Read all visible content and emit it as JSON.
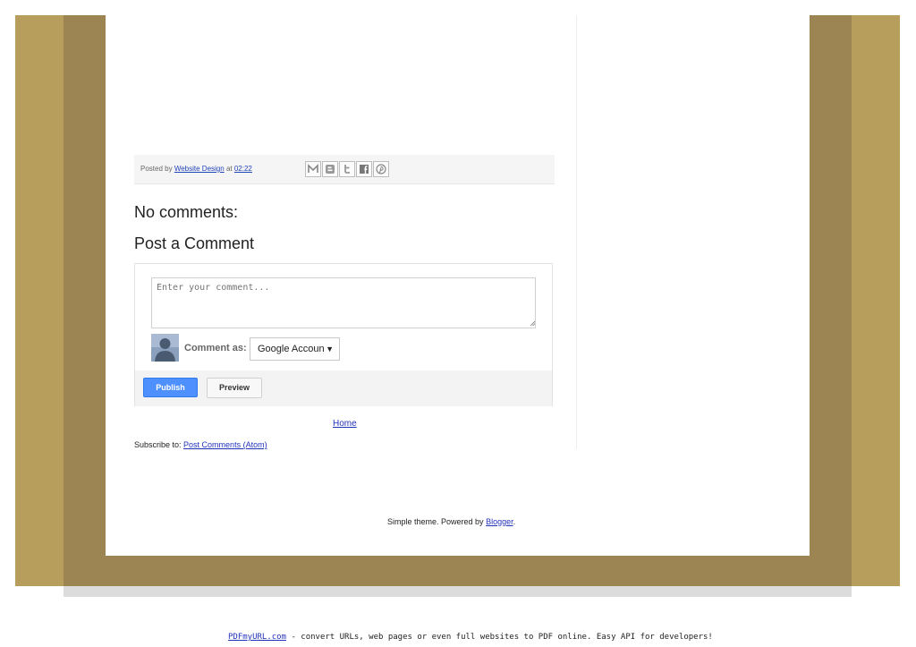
{
  "post_footer": {
    "posted_by_prefix": "Posted by",
    "author": "Website Design",
    "at_label": "at",
    "time": "02:22",
    "share_icons": [
      "email-icon",
      "blogger-icon",
      "twitter-icon",
      "facebook-icon",
      "pinterest-icon"
    ]
  },
  "comments_heading": "No comments:",
  "post_comment_heading": "Post a Comment",
  "comment_form": {
    "placeholder": "Enter your comment...",
    "comment_as_label": "Comment as:",
    "account_selected": "Google Accoun",
    "publish_label": "Publish",
    "preview_label": "Preview"
  },
  "home_link": "Home",
  "subscribe": {
    "prefix": "Subscribe to:",
    "link": "Post Comments (Atom)"
  },
  "attribution": {
    "text": "Simple theme. Powered by",
    "link": "Blogger",
    "suffix": "."
  },
  "pdf_footer": {
    "link": "PDFmyURL.com",
    "text": " - convert URLs, web pages or even full websites to PDF online. Easy API for developers!"
  },
  "colors": {
    "background_gold": "#b89e5c",
    "background_dark": "#9c8453",
    "link": "#2233bb",
    "publish_button": "#4d90fe"
  }
}
